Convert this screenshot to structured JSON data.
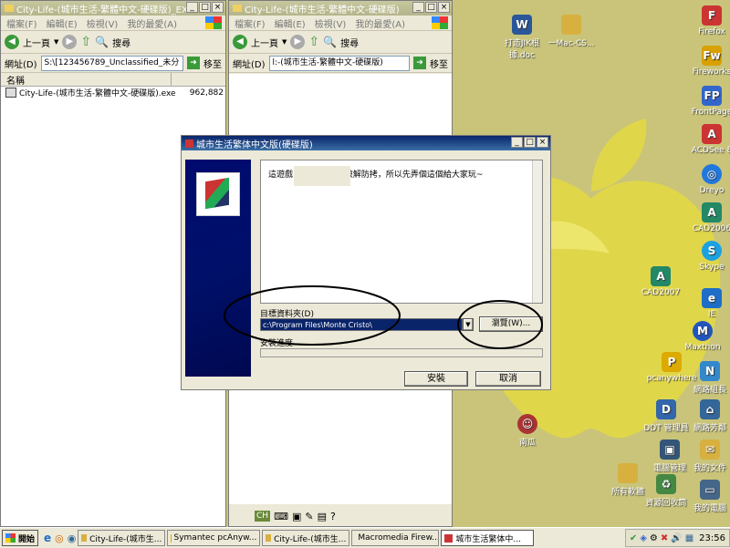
{
  "explorer_left": {
    "title": "City-Life-(城市生活-繁體中文-硬碟版)_EXE",
    "menu": [
      "檔案(F)",
      "編輯(E)",
      "檢視(V)",
      "我的最愛(A)"
    ],
    "back": "上一頁",
    "search": "搜尋",
    "address_label": "網址(D)",
    "address_value": "S:\\[123456789_Unclassified_未分",
    "go": "移至",
    "col_name": "名稱",
    "file_name": "City-Life-(城市生活-繁體中文-硬碟版).exe",
    "file_size": "962,882"
  },
  "explorer_right": {
    "title": "City-Life-(城市生活-繁體中文-硬碟版)",
    "menu": [
      "檔案(F)",
      "編輯(E)",
      "檢視(V)",
      "我的最愛(A)"
    ],
    "back": "上一頁",
    "search": "搜尋",
    "address_label": "網址(D)",
    "address_value": "l:-(城市生活-繁體中文-硬碟版)",
    "go": "移至"
  },
  "installer": {
    "title": "城市生活繁体中文版(硬碟版)",
    "message": "這遊戲          因爲暫時無法破解防拷，所以先弄個這個給大家玩~",
    "dest_label": "目標資料夾(D)",
    "dest_value": "c:\\Program Files\\Monte Cristo\\",
    "browse": "瀏覽(W)...",
    "progress_label": "安裝進度",
    "progress": 0,
    "install": "安裝",
    "cancel": "取消"
  },
  "desktop_icons": [
    {
      "label": "Firefox",
      "icon": "firefox-icon",
      "color": "#c33"
    },
    {
      "label": "Fireworks",
      "icon": "fireworks-icon",
      "color": "#d8a000"
    },
    {
      "label": "FrontPage",
      "icon": "frontpage-icon",
      "color": "#3366cc"
    },
    {
      "label": "ACDSee 8",
      "icon": "acdsee-icon",
      "color": "#cc3333"
    },
    {
      "label": "Dreyo",
      "icon": "dreyo-icon",
      "color": "#2277dd"
    },
    {
      "label": "CAD2006",
      "icon": "cad-icon",
      "color": "#228866"
    },
    {
      "label": "Skype",
      "icon": "skype-icon",
      "color": "#1ba1e2"
    },
    {
      "label": "IE",
      "icon": "ie-icon",
      "color": "#1e6ec8"
    },
    {
      "label": "Maxthon",
      "icon": "maxthon-icon",
      "color": "#2255bb"
    },
    {
      "label": "資源回收筒",
      "icon": "recycle-bin-icon",
      "color": "#448844"
    },
    {
      "label": "網路芳鄰",
      "icon": "network-icon",
      "color": "#336699"
    },
    {
      "label": "我的文件",
      "icon": "my-documents-icon",
      "color": "#d8b040"
    },
    {
      "label": "我的電腦",
      "icon": "my-computer-icon",
      "color": "#446688"
    },
    {
      "label": "電腦管理",
      "icon": "computer-manage-icon",
      "color": "#335577"
    },
    {
      "label": "所有軟體",
      "icon": "folder-icon",
      "color": "#d8b040"
    },
    {
      "label": "CAD2007",
      "icon": "cad2007-icon",
      "color": "#228866"
    },
    {
      "label": "南瓜",
      "icon": "character-icon",
      "color": "#aa3333"
    },
    {
      "label": "打造JIK根據.doc",
      "icon": "word-doc-icon",
      "color": "#2b579a"
    },
    {
      "label": "一Mac-CS...",
      "icon": "folder-icon",
      "color": "#d8b040"
    },
    {
      "label": "pcanywhere",
      "icon": "pcanywhere-icon",
      "color": "#ddaa00"
    },
    {
      "label": "網路組長",
      "icon": "net-icon",
      "color": "#3388cc"
    },
    {
      "label": "DDT 管理員",
      "icon": "ddt-icon",
      "color": "#3366aa"
    }
  ],
  "taskbar": {
    "start": "開始",
    "items": [
      "City-Life-(城市生...",
      "Symantec pcAnyw...",
      "City-Life-(城市生...",
      "Macromedia Firew...",
      "城市生活繁体中..."
    ],
    "clock": "23:56",
    "lang": "CH"
  }
}
